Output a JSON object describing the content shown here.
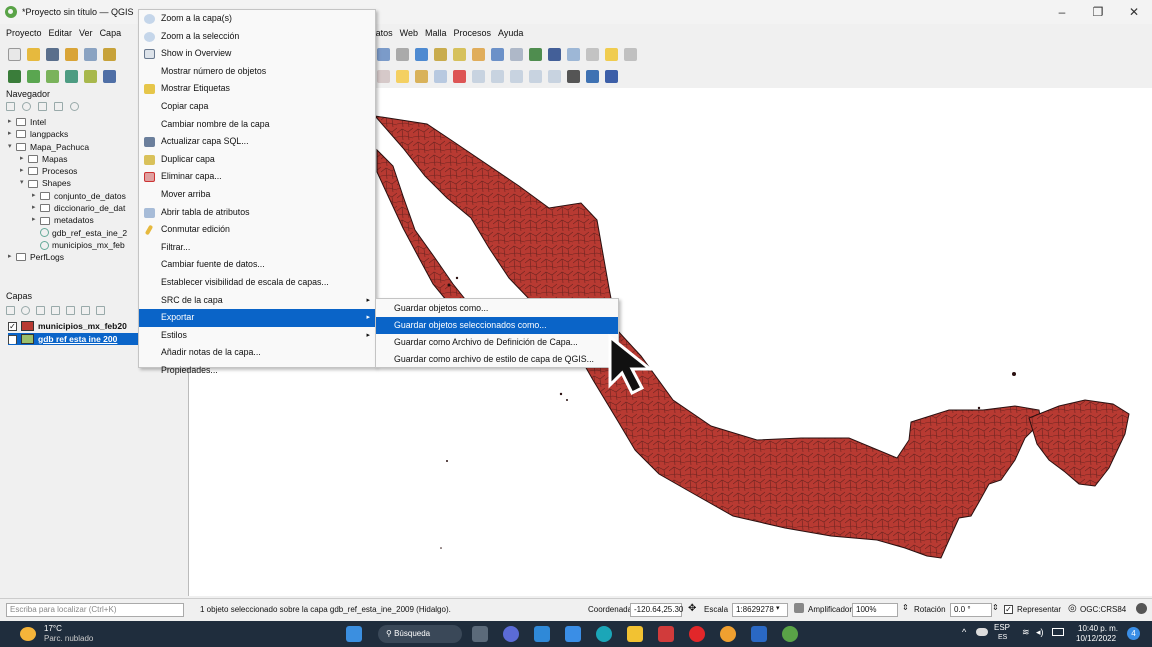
{
  "window": {
    "title": "*Proyecto sin título — QGIS"
  },
  "menubar": [
    "Proyecto",
    "Editar",
    "Ver",
    "Capa",
    "de datos",
    "Web",
    "Malla",
    "Procesos",
    "Ayuda"
  ],
  "navigator": {
    "title": "Navegador",
    "items": [
      {
        "label": "Intel",
        "arrow": "▸"
      },
      {
        "label": "langpacks",
        "arrow": "▸"
      },
      {
        "label": "Mapa_Pachuca",
        "arrow": "▾"
      },
      {
        "label": "Mapas",
        "arrow": "▸"
      },
      {
        "label": "Procesos",
        "arrow": "▸"
      },
      {
        "label": "Shapes",
        "arrow": "▾"
      },
      {
        "label": "conjunto_de_datos",
        "arrow": "▸"
      },
      {
        "label": "diccionario_de_dat",
        "arrow": "▸"
      },
      {
        "label": "metadatos",
        "arrow": "▸"
      },
      {
        "label": "gdb_ref_esta_ine_2",
        "arrow": ""
      },
      {
        "label": "municipios_mx_feb",
        "arrow": ""
      },
      {
        "label": "PerfLogs",
        "arrow": "▸"
      }
    ]
  },
  "layers": {
    "title": "Capas",
    "rows": [
      {
        "label": "municipios_mx_feb20",
        "color": "#b83a32",
        "checked": "✓"
      },
      {
        "label": "gdb ref esta ine 200",
        "color": "#9bbf6a",
        "checked": "✓"
      }
    ]
  },
  "context_menu": {
    "items": [
      {
        "label": "Zoom a la capa(s)",
        "icon": "zoom-layer-icon"
      },
      {
        "label": "Zoom a la selección",
        "icon": "zoom-selection-icon"
      },
      {
        "label": "Show in Overview",
        "icon": "overview-icon"
      },
      {
        "label": "Mostrar número de objetos",
        "icon": ""
      },
      {
        "label": "Mostrar Etiquetas",
        "icon": "labels-icon"
      },
      {
        "label": "Copiar capa",
        "icon": ""
      },
      {
        "label": "Cambiar nombre de la capa",
        "icon": ""
      },
      {
        "label": "Actualizar capa SQL...",
        "icon": "sql-icon"
      },
      {
        "label": "Duplicar capa",
        "icon": "duplicate-icon"
      },
      {
        "label": "Eliminar capa...",
        "icon": "remove-layer-icon"
      },
      {
        "label": "Mover arriba",
        "icon": ""
      },
      {
        "label": "Abrir tabla de atributos",
        "icon": "attribute-table-icon"
      },
      {
        "label": "Conmutar edición",
        "icon": "pencil-icon"
      },
      {
        "label": "Filtrar...",
        "icon": ""
      },
      {
        "label": "Cambiar fuente de datos...",
        "icon": ""
      },
      {
        "label": "Establecer visibilidad de escala de capas...",
        "icon": ""
      },
      {
        "label": "SRC de la capa",
        "icon": "",
        "submenu": "▸"
      },
      {
        "label": "Exportar",
        "icon": "",
        "submenu": "▸",
        "selected": true
      },
      {
        "label": "Estilos",
        "icon": "",
        "submenu": "▸"
      },
      {
        "label": "Añadir notas de la capa...",
        "icon": ""
      },
      {
        "label": "Propiedades...",
        "icon": ""
      }
    ]
  },
  "export_submenu": {
    "items": [
      {
        "label": "Guardar objetos como..."
      },
      {
        "label": "Guardar objetos seleccionados como...",
        "selected": true
      },
      {
        "label": "Guardar como Archivo de Definición de Capa..."
      },
      {
        "label": "Guardar como archivo de estilo de capa de QGIS..."
      }
    ]
  },
  "statusbar": {
    "locate_placeholder": "Escriba para localizar (Ctrl+K)",
    "message": "1 objeto seleccionado sobre la capa gdb_ref_esta_ine_2009 (Hidalgo).",
    "coord_label": "Coordenada",
    "coord_value": "-120.64,25.30",
    "scale_label": "Escala",
    "scale_value": "1:8629278",
    "magnifier_label": "Amplificador",
    "magnifier_value": "100%",
    "rotation_label": "Rotación",
    "rotation_value": "0.0 °",
    "render_label": "Representar",
    "crs": "OGC:CRS84"
  },
  "taskbar": {
    "temp": "17°C",
    "weather": "Parc. nublado",
    "search": "Búsqueda",
    "lang": "ESP",
    "lang_sub": "ES",
    "time": "10:40 p. m.",
    "date": "10/12/2022",
    "notif_count": "4"
  },
  "colors": {
    "map_fill": "#b83a32",
    "map_line": "#2a1010",
    "selection": "#0a64c8"
  }
}
